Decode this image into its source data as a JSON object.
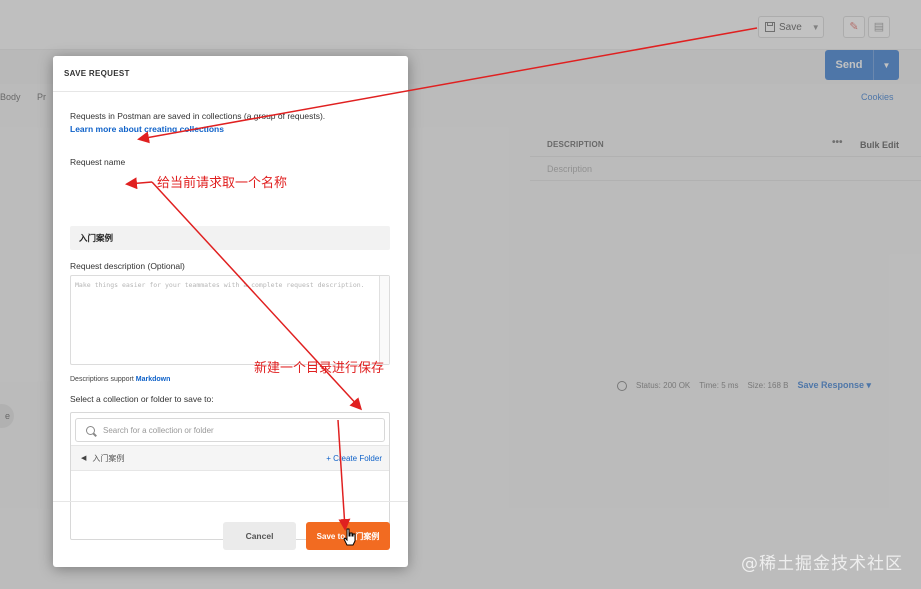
{
  "app": {
    "save_label": "Save",
    "send_label": "Send",
    "tabs": [
      "Body",
      "Pr"
    ],
    "cookies_label": "Cookies",
    "desc_header": "DESCRIPTION",
    "dots_label": "•••",
    "bulk_edit_label": "Bulk Edit",
    "desc_placeholder": "Description",
    "status": {
      "status_text": "Status: 200 OK",
      "time_text": "Time: 5 ms",
      "size_text": "Size: 168 B",
      "save_response_label": "Save Response"
    },
    "left_pill_label": "e"
  },
  "modal": {
    "title": "SAVE REQUEST",
    "intro_text": "Requests in Postman are saved in collections (a group of requests).",
    "learn_more_link": "Learn more about creating collections",
    "request_name_label": "Request name",
    "request_name_value": "入门案例",
    "request_desc_label": "Request description (Optional)",
    "request_desc_placeholder": "Make things easier for your teammates with a complete request description.",
    "md_note_prefix": "Descriptions support",
    "md_note_link": "Markdown",
    "collection_label": "Select a collection or folder to save to:",
    "search_placeholder": "Search for a collection or folder",
    "current_folder": "入门案例",
    "create_folder_label": "+ Create Folder",
    "cancel_label": "Cancel",
    "save_button_label": "Save to 入门案例"
  },
  "annotations": {
    "note_name": "给当前请求取一个名称",
    "note_folder": "新建一个目录进行保存",
    "color": "#e02020"
  },
  "watermark": "@稀土掘金技术社区",
  "colors": {
    "primary_blue": "#0f62c9",
    "save_orange": "#f26b21"
  }
}
